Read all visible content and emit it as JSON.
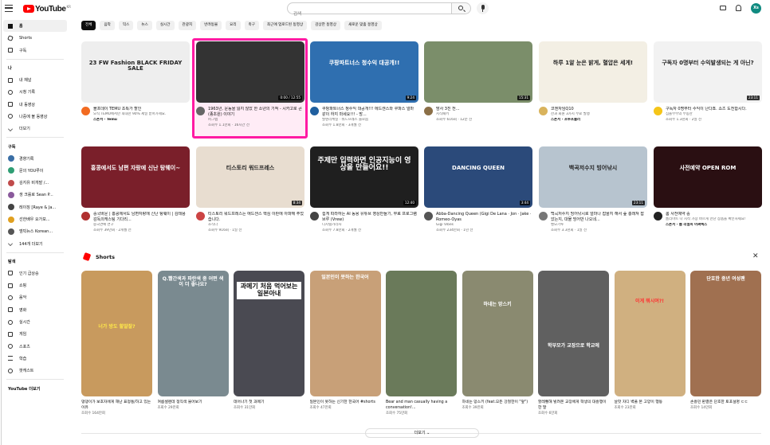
{
  "header": {
    "logo": "YouTube",
    "logo_region": "KR",
    "search_placeholder": "검색",
    "avatar": "Xs"
  },
  "sidebar": {
    "main": [
      {
        "label": "홈",
        "icon": "home-icon"
      },
      {
        "label": "Shorts",
        "icon": "shorts-icon"
      },
      {
        "label": "구독",
        "icon": "subscriptions-icon"
      }
    ],
    "you_header": "나",
    "you": [
      {
        "label": "내 채널",
        "icon": "channel-icon"
      },
      {
        "label": "시청 기록",
        "icon": "history-icon"
      },
      {
        "label": "내 동영상",
        "icon": "video-icon"
      },
      {
        "label": "나중에 볼 동영상",
        "icon": "watch-later-icon"
      },
      {
        "label": "더보기",
        "icon": "chevron-down-icon"
      }
    ],
    "subs_header": "구독",
    "subs": [
      {
        "label": "경향기록",
        "color": "#3a6ea5"
      },
      {
        "label": "문의 YOU루이",
        "color": "#2f9e74"
      },
      {
        "label": "김지유 비개발 /...",
        "color": "#c04b4b"
      },
      {
        "label": "생 크롤로 Sean P...",
        "color": "#8a5a9c"
      },
      {
        "label": "레이징 [Raye & Ja...",
        "color": "#444"
      },
      {
        "label": "선한배우 요가보...",
        "color": "#e0a020"
      },
      {
        "label": "엠빅뉴스 Korean...",
        "color": "#555"
      },
      {
        "label": "144개 더보기",
        "color": ""
      }
    ],
    "explore_header": "탐색",
    "explore": [
      {
        "label": "인기 급상승",
        "icon": "trending-icon"
      },
      {
        "label": "쇼핑",
        "icon": "shopping-icon"
      },
      {
        "label": "음악",
        "icon": "music-icon"
      },
      {
        "label": "영화",
        "icon": "movie-icon"
      },
      {
        "label": "실시간",
        "icon": "live-icon"
      },
      {
        "label": "게임",
        "icon": "game-icon"
      },
      {
        "label": "스포츠",
        "icon": "sports-icon"
      },
      {
        "label": "학습",
        "icon": "learning-icon"
      },
      {
        "label": "팟캐스트",
        "icon": "podcast-icon"
      }
    ],
    "more_header": "YouTube 더보기"
  },
  "chips": [
    "전체",
    "음악",
    "믹스",
    "뉴스",
    "실시간",
    "관광지",
    "반려동물",
    "요리",
    "축구",
    "최근에 업로드된 동영상",
    "감상한 동영상",
    "새로운 맞춤 동영상"
  ],
  "videos": [
    {
      "title": "블프데이 TEMU 초특가 할인",
      "line1": "오직 TEMU에서만 최대한 90% 세일 받아가세요.",
      "line2": "스폰서 · Temu",
      "duration": "",
      "thumb_text": "23 FW Fashion BLACK FRIDAY SALE",
      "bg": "#eeeeee",
      "av": "#f26b21",
      "sponsor": true
    },
    {
      "title": "1963년, 운동을 잃지 않았 한 소년의 기적 - 시카고로 큰 (종초원) 이야기",
      "line1": "퍼그랩",
      "line2": "조회수 1.1만회 · 16시간 전",
      "duration": "0:00 / 12:55",
      "thumb_text": "",
      "bg": "#333333",
      "av": "#666666",
      "sponsor": false
    },
    {
      "title": "쿠팡파트너스 청수익 대공개!!! 에드센스와 쿠파스 얼마 같이 하지 마세요!!! - 방...",
      "line1": "발엔리케일 · 워드프레스 블로몸",
      "line2": "조회수 1.8만회 · 3개월 전",
      "duration": "9:24",
      "thumb_text": "쿠팡파트너스 청수익 대공개!!",
      "bg": "#2f6fb0",
      "av": "#1f5f9f",
      "sponsor": false
    },
    {
      "title": "밤사 3친 전...",
      "line1": "지식패키",
      "line2": "조회수 616회 · 12분 전",
      "duration": "15:31",
      "thumb_text": "",
      "bg": "#7b8e6a",
      "av": "#8b6f47",
      "sponsor": false
    },
    {
      "title": "코엔자임Q10",
      "line1": "산과 회원 3가지 무료 발행",
      "line2": "스폰서 · 프루프플러",
      "duration": "",
      "thumb_text": "하루 1알 눈은 밝게, 혈압은 세게!",
      "bg": "#f3efe4",
      "av": "#d9b35c",
      "sponsor": true
    },
    {
      "title": "구독자 0명부터 수익이 난다죠. 쇼츠 도전합시다.",
      "line1": "심플부부의 부동산",
      "line2": "조회수 1.3천회 · 2일 전",
      "duration": "23:11",
      "thumb_text": "구독자 0명부터 수익발생되는 게 아닌?",
      "bg": "#f2f2f2",
      "av": "#f5c518",
      "sponsor": false
    },
    {
      "title": "중국바운 | 홍콩에서도 남편자랑에 신난 탕웨이 | 김태용 감독의캐스팅 기다리...",
      "line1": "중국연예 연구",
      "line2": "조회수 39만회 · 2개월 전",
      "duration": "",
      "thumb_text": "홍콩에서도 남편 자랑에 신난 탕웨이~",
      "bg": "#7a1f2a",
      "av": "#b03030",
      "sponsor": false
    },
    {
      "title": "티스토리 워드프레스는 애드센스 핵심 이란에 아파해 주었습니다.",
      "line1": "조식다",
      "line2": "조회수 916회 · 1일 전",
      "duration": "8:34",
      "thumb_text": "티스토리 워드프레스",
      "bg": "#e8ddd0",
      "av": "#c44",
      "sponsor": false
    },
    {
      "title": "쉽게 따라하는 AI 동용 유튜브 영상만들기, 무료 프로그램 브루 (Vrew)",
      "line1": "디지털가리사",
      "line2": "조회수 7.8만회 · 2개월 전",
      "duration": "12:40",
      "thumb_text": "주제만 입력하면 인공지능이 영상을 만들어요!!",
      "bg": "#1f1f1f",
      "av": "#444",
      "sponsor": false
    },
    {
      "title": "Abba-Dancing Queen (Gigi De Lana · Jon · Jake · Romeo-Oyas",
      "line1": "Gigi Vibes",
      "line2": "조회수 234만회 · 1년 전",
      "duration": "3:44",
      "thumb_text": "DANCING QUEEN",
      "bg": "#2b4a7a",
      "av": "#555",
      "sponsor": false
    },
    {
      "title": "백곡저수지 빙어낚시로 얼마나 잡을지 해서 숲 충래져 잡았는지, 대물 빙어만 나오네...",
      "line1": "벤모기루",
      "line2": "조회수 3.3천회 · 1일 전",
      "duration": "23:11",
      "thumb_text": "백곡저수지 빙어낚시",
      "bg": "#b7c4cf",
      "av": "#777",
      "sponsor": false
    },
    {
      "title": "롬 사전예약 중",
      "line1": "롬리마트 나 시작 가장 바르게 만난 상품을 확인하세요!",
      "line2": "스폰서 · 롬 리얼피 어쩌렉스",
      "duration": "",
      "thumb_text": "사전예약 OPEN ROM",
      "bg": "#2a0f12",
      "av": "#222",
      "sponsor": true
    }
  ],
  "shorts": {
    "title": "Shorts",
    "items": [
      {
        "title": "댕댕이가 보호자에게 해난 표정통/하고 있는 이유",
        "views": "조회수 164만회",
        "caption": "너가 방도 할말잘?",
        "bg": "#c89a5e"
      },
      {
        "title": "여름셀렌데 정직색 물어보기",
        "views": "조회수 29만회",
        "caption": "Q.빨간색과 파란색 중 어떤 색이 더 좋나요?",
        "bg": "#7a8a90"
      },
      {
        "title": "데어나기 첫 과메기",
        "views": "조회수 31만회",
        "caption": "과메기 처음 먹어보는 일본아내",
        "bg": "#4a4a52"
      },
      {
        "title": "일본인이 못하는 신기한 한국어 #shorts",
        "views": "조회수 47만회",
        "caption": "일본인이 못하는 한국어",
        "bg": "#c8a078"
      },
      {
        "title": "Bear and man casually having a conversation!...",
        "views": "조회수 75만회",
        "caption": "",
        "bg": "#6a7a5a"
      },
      {
        "title": "하네는 망스키 (feat.모든 강철한이 \"앞\")",
        "views": "조회수 39만회",
        "caption": "하네는 망스키",
        "bg": "#8a8a70"
      },
      {
        "title": "할레뻘해 빌려온 교장에게 학생의 대흥행이 한 말",
        "views": "조회수 6만회",
        "caption": "학부모가 교장으로 학교에",
        "bg": "#606060"
      },
      {
        "title": "날핫 자디 벽풀 본 고양이 행동",
        "views": "조회수 23만회",
        "caption": "이게 뭐시여?!",
        "bg": "#d0b080"
      },
      {
        "title": "손흥민 판결은 단호한 토포설명 ㄷㄷ",
        "views": "조회수 14만회",
        "caption": "단호한 중년 여성팬",
        "bg": "#a07050"
      }
    ]
  },
  "more_button": "더보기"
}
